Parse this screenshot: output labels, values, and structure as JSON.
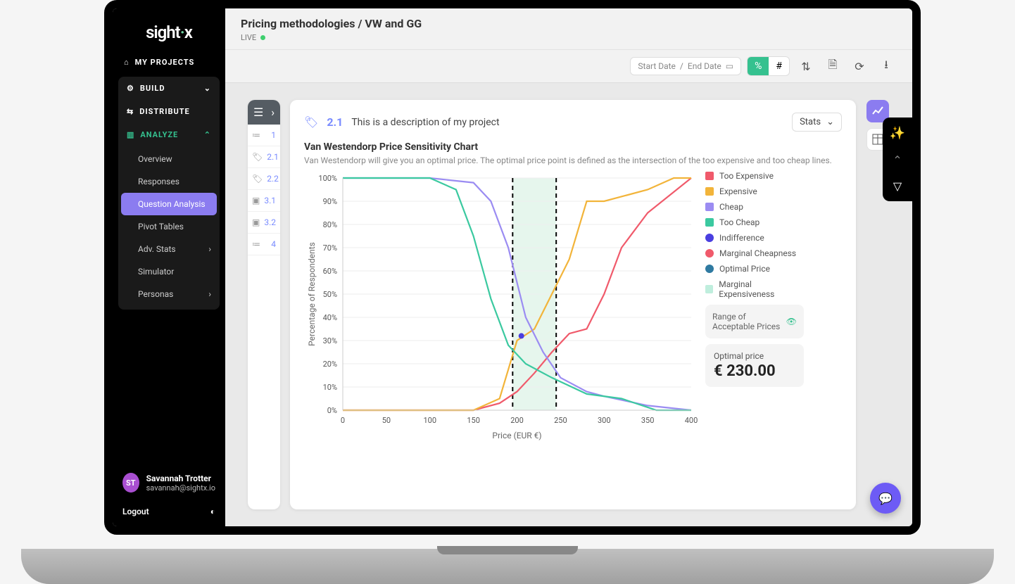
{
  "logo": {
    "brand": "sight",
    "suffix": "x"
  },
  "nav": {
    "myProjects": "MY PROJECTS",
    "build": "BUILD",
    "distribute": "DISTRIBUTE",
    "analyze": "ANALYZE",
    "analyzeItems": {
      "overview": "Overview",
      "responses": "Responses",
      "qa": "Question Analysis",
      "pivot": "Pivot Tables",
      "adv": "Adv. Stats",
      "sim": "Simulator",
      "personas": "Personas"
    }
  },
  "user": {
    "initials": "ST",
    "name": "Savannah Trotter",
    "email": "savannah@sightx.io",
    "logout": "Logout"
  },
  "header": {
    "breadcrumb": "Pricing methodologies / VW and GG",
    "status": "LIVE"
  },
  "toolbar": {
    "startDate": "Start Date",
    "endDate": "End Date"
  },
  "qnav": {
    "items": [
      "1",
      "2.1",
      "2.2",
      "3.1",
      "3.2",
      "4"
    ]
  },
  "card": {
    "qnum": "2.1",
    "desc": "This is a description of my project",
    "statsLabel": "Stats",
    "title": "Van Westendorp Price Sensitivity Chart",
    "sub": "Van Westendorp will give you an optimal price. The optimal price point is defined as the intersection of the too expensive and too cheap lines."
  },
  "legend": {
    "tooExpensive": "Too Expensive",
    "expensive": "Expensive",
    "cheap": "Cheap",
    "tooCheap": "Too Cheap",
    "indiff": "Indifference",
    "margCheap": "Marginal Cheapness",
    "optPrice": "Optimal Price",
    "margExp": "Marginal Expensiveness",
    "rangeBox": "Range of Acceptable Prices",
    "optLabel": "Optimal price",
    "optValue": "€ 230.00"
  },
  "colors": {
    "tooExpensive": "#f05a6b",
    "expensive": "#f2b43a",
    "cheap": "#9b8cf2",
    "tooCheap": "#3bc9a0",
    "indiff": "#4a3fe0",
    "margCheap": "#f05a6b",
    "optPrice": "#2f7aa1",
    "margExp": "#bfeedd",
    "band": "#e6f6ed"
  },
  "chart_data": {
    "type": "line",
    "xlabel": "Price (EUR €)",
    "ylabel": "Percentage of Respondents",
    "xlim": [
      0,
      400
    ],
    "ylim": [
      0,
      100
    ],
    "xticks": [
      0,
      50,
      100,
      150,
      200,
      250,
      300,
      350,
      400
    ],
    "yticks": [
      0,
      10,
      20,
      30,
      40,
      50,
      60,
      70,
      80,
      90,
      100
    ],
    "acceptable_range": [
      195,
      245
    ],
    "optimal_price": 230,
    "indifference_point": {
      "x": 205,
      "y": 32
    },
    "series": [
      {
        "name": "Too Expensive",
        "color": "#f05a6b",
        "x": [
          0,
          50,
          100,
          150,
          180,
          200,
          220,
          240,
          260,
          280,
          300,
          320,
          350,
          400
        ],
        "y": [
          0,
          0,
          0,
          0,
          3,
          8,
          16,
          25,
          33,
          35,
          50,
          70,
          85,
          100
        ]
      },
      {
        "name": "Expensive",
        "color": "#f2b43a",
        "x": [
          0,
          50,
          100,
          150,
          180,
          200,
          220,
          240,
          260,
          280,
          300,
          350,
          380,
          400
        ],
        "y": [
          0,
          0,
          0,
          0,
          5,
          30,
          35,
          50,
          65,
          90,
          90,
          95,
          100,
          100
        ]
      },
      {
        "name": "Cheap",
        "color": "#9b8cf2",
        "x": [
          0,
          50,
          100,
          150,
          170,
          190,
          210,
          230,
          250,
          280,
          300,
          350,
          400
        ],
        "y": [
          100,
          100,
          100,
          98,
          90,
          70,
          40,
          25,
          14,
          8,
          6,
          2,
          0
        ]
      },
      {
        "name": "Too Cheap",
        "color": "#3bc9a0",
        "x": [
          0,
          50,
          100,
          130,
          150,
          170,
          190,
          210,
          240,
          280,
          320,
          360,
          400
        ],
        "y": [
          100,
          100,
          100,
          95,
          75,
          48,
          28,
          20,
          14,
          7,
          5,
          0,
          0
        ]
      }
    ]
  }
}
